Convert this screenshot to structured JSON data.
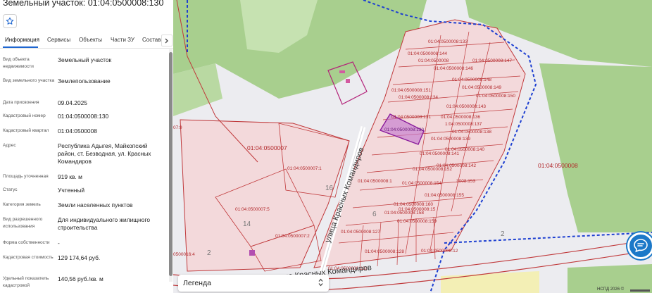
{
  "panel": {
    "title": "Земельный участок: 01:04:0500008:130",
    "tabs": [
      "Информация",
      "Сервисы",
      "Объекты",
      "Части ЗУ",
      "Состав"
    ],
    "fields": [
      {
        "label": "Вид объекта недвижимости",
        "value": "Земельный участок"
      },
      {
        "label": "Вид земельного участка",
        "value": "Землепользование"
      },
      {
        "label": "Дата присвоения",
        "value": "09.04.2025"
      },
      {
        "label": "Кадастровый номер",
        "value": "01:04:0500008:130"
      },
      {
        "label": "Кадастровый квартал",
        "value": "01:04:0500008"
      },
      {
        "label": "Адрес",
        "value": "Республика Адыгея, Майкопский район, ст. Безводная, ул. Красных Командиров"
      },
      {
        "label": "Площадь уточненная",
        "value": "919 кв. м"
      },
      {
        "label": "Статус",
        "value": "Учтенный"
      },
      {
        "label": "Категория земель",
        "value": "Земли населенных пунктов"
      },
      {
        "label": "Вид разрешенного использования",
        "value": "Для индивидуального жилищного строительства"
      },
      {
        "label": "Форма собственности",
        "value": "-"
      },
      {
        "label": "Кадастровая стоимость",
        "value": "129 174,64 руб."
      },
      {
        "label": "Удельный показатель кадастровой",
        "value": "140,56 руб./кв. м"
      }
    ]
  },
  "map": {
    "quarters": [
      "01:04:0500007",
      "01:04:0500008"
    ],
    "selected_parcel": "01:04:0500008:130",
    "streets": [
      "улица Красных Командиров",
      "улица Красных Командиров"
    ],
    "parcels": [
      "01:04:0500008:133",
      "01:04:0500008:144",
      "01:04:0500008",
      "01:04:0500008:147",
      "01:04:0500008:146",
      "01:04:0500008:148",
      "01:04:0500008:149",
      "01:04:0500008:151",
      "01:04:0500008:134",
      "01:04:0500008:150",
      "01:04:0500008:143",
      "01:04:0500008:131",
      "01:04:0500008:136",
      "1:04:0500008:137",
      "01:04:0500008:138",
      "01:04:0500008:139",
      "01:04:0500008:140",
      "01:04:0500008:141",
      "01:04:0500008:142",
      "01:04:0500008:152",
      "3008:153",
      "01:04:0500008:154",
      "01:04:0500008:155",
      "01:04:0500008:160",
      "01:04:0500008:15",
      "01:04:0500008:158",
      "01:04:0500008:159",
      "01:04:0500008:1",
      "01:04:0500008:127",
      "01:04:0500008:128",
      "01:04:0500008:12",
      "01:04:0500008:132",
      "01:04:0500007:1",
      "01:04:0500007:5",
      "01:04:0500007:2",
      "0500016:4",
      "07:9"
    ],
    "house_numbers": [
      "16",
      "6",
      "14",
      "2",
      "2"
    ],
    "legend_label": "Легенда",
    "attribution": "НСПД 2026 ©"
  },
  "colors": {
    "accent": "#1e66d0",
    "parcel_border": "#c0393b",
    "parcel_fill": "#f3d9db",
    "selected_fill": "#c47bcf",
    "quarter_border": "#1d3fd1",
    "forest": "#a8cf8e",
    "chat_button": "#1b78c8"
  }
}
